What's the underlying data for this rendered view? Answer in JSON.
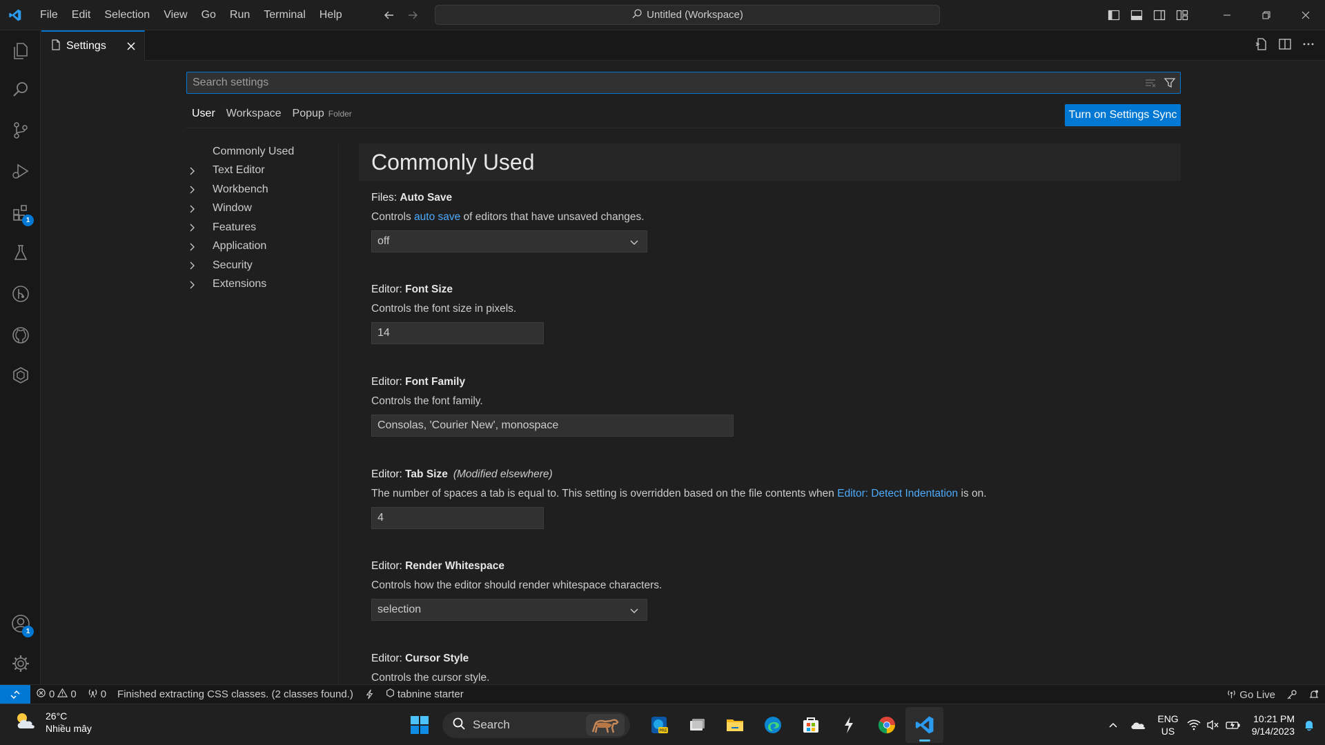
{
  "titlebar": {
    "menu": [
      "File",
      "Edit",
      "Selection",
      "View",
      "Go",
      "Run",
      "Terminal",
      "Help"
    ],
    "command_center": "Untitled (Workspace)"
  },
  "tab": {
    "label": "Settings"
  },
  "settings": {
    "search_placeholder": "Search settings",
    "scope_tabs": {
      "user": "User",
      "workspace": "Workspace",
      "popup": "Popup",
      "folder": "Folder"
    },
    "sync_button": "Turn on Settings Sync",
    "toc": {
      "commonly_used": "Commonly Used",
      "items": [
        "Text Editor",
        "Workbench",
        "Window",
        "Features",
        "Application",
        "Security",
        "Extensions"
      ]
    },
    "section_title": "Commonly Used",
    "items": {
      "autosave": {
        "category": "Files: ",
        "key": "Auto Save",
        "desc_pre": "Controls ",
        "desc_link": "auto save",
        "desc_post": " of editors that have unsaved changes.",
        "value": "off"
      },
      "fontsize": {
        "category": "Editor: ",
        "key": "Font Size",
        "desc": "Controls the font size in pixels.",
        "value": "14"
      },
      "fontfamily": {
        "category": "Editor: ",
        "key": "Font Family",
        "desc": "Controls the font family.",
        "value": "Consolas, 'Courier New', monospace"
      },
      "tabsize": {
        "category": "Editor: ",
        "key": "Tab Size",
        "modified": "(Modified elsewhere)",
        "desc_pre": "The number of spaces a tab is equal to. This setting is overridden based on the file contents when ",
        "desc_link": "Editor: Detect Indentation",
        "desc_post": " is on.",
        "value": "4"
      },
      "whitespace": {
        "category": "Editor: ",
        "key": "Render Whitespace",
        "desc": "Controls how the editor should render whitespace characters.",
        "value": "selection"
      },
      "cursor": {
        "category": "Editor: ",
        "key": "Cursor Style",
        "desc": "Controls the cursor style."
      }
    }
  },
  "activity_badges": {
    "extensions": "1",
    "accounts": "1"
  },
  "statusbar": {
    "errors": "0",
    "warnings": "0",
    "ports": "0",
    "message": "Finished extracting CSS classes. (2 classes found.)",
    "tabnine": "tabnine starter",
    "go_live": "Go Live"
  },
  "taskbar": {
    "weather_temp": "26°C",
    "weather_desc": "Nhiều mây",
    "search": "Search",
    "lang1": "ENG",
    "lang2": "US",
    "time": "10:21 PM",
    "date": "9/14/2023"
  },
  "colors": {
    "accent": "#0078d4",
    "link": "#4daafc",
    "background": "#1f1f1f"
  }
}
